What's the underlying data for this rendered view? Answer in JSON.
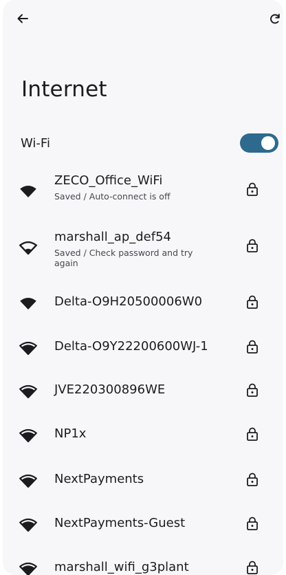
{
  "header": {
    "title": "Internet",
    "back_icon": "arrow-left-icon",
    "refresh_icon": "refresh-icon"
  },
  "wifi": {
    "label": "Wi-Fi",
    "enabled": true,
    "toggle_color": "#2d6a8e"
  },
  "networks": [
    {
      "name": "ZECO_Office_WiFi",
      "status": "Saved / Auto-connect is off",
      "signal": "full",
      "secured": true
    },
    {
      "name": "marshall_ap_def54",
      "status": "Saved / Check password and try again",
      "signal": "outline",
      "secured": true
    },
    {
      "name": "Delta-O9H20500006W0",
      "status": "",
      "signal": "full",
      "secured": true
    },
    {
      "name": "Delta-O9Y22200600WJ-1",
      "status": "",
      "signal": "strong",
      "secured": true
    },
    {
      "name": "JVE220300896WE",
      "status": "",
      "signal": "strong",
      "secured": true
    },
    {
      "name": "NP1x",
      "status": "",
      "signal": "strong",
      "secured": true
    },
    {
      "name": "NextPayments",
      "status": "",
      "signal": "strong",
      "secured": true
    },
    {
      "name": "NextPayments-Guest",
      "status": "",
      "signal": "strong",
      "secured": true
    },
    {
      "name": "marshall_wifi_g3plant",
      "status": "",
      "signal": "strong",
      "secured": true
    }
  ]
}
